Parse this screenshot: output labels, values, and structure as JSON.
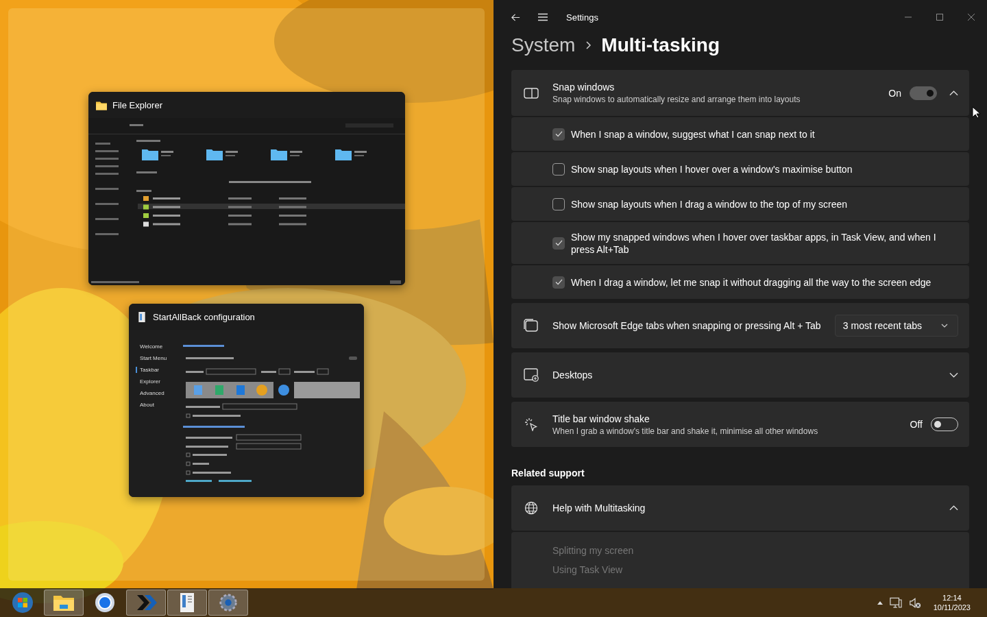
{
  "snap_assist": {
    "windows": [
      {
        "kind": "explorer",
        "title": "File Explorer"
      },
      {
        "kind": "startallback",
        "title": "StartAllBack configuration",
        "nav": [
          {
            "label": "Welcome",
            "selected": false
          },
          {
            "label": "Start Menu",
            "selected": false
          },
          {
            "label": "Taskbar",
            "selected": true
          },
          {
            "label": "Explorer",
            "selected": false
          },
          {
            "label": "Advanced",
            "selected": false
          },
          {
            "label": "About",
            "selected": false
          }
        ]
      }
    ]
  },
  "settings": {
    "window": {
      "title": "Settings"
    },
    "breadcrumb": [
      "System",
      "Multi-tasking"
    ],
    "snap_windows": {
      "title": "Snap windows",
      "description": "Snap windows to automatically resize and arrange them into layouts",
      "state_label": "On",
      "on": true,
      "expanded": true,
      "options": [
        {
          "label": "When I snap a window, suggest what I can snap next to it",
          "checked": true
        },
        {
          "label": "Show snap layouts when I hover over a window's maximise button",
          "checked": false
        },
        {
          "label": "Show snap layouts when I drag a window to the top of my screen",
          "checked": false
        },
        {
          "label": "Show my snapped windows when I hover over taskbar apps, in Task View, and when I press Alt+Tab",
          "checked": true
        },
        {
          "label": "When I drag a window, let me snap it without dragging all the way to the screen edge",
          "checked": true
        }
      ]
    },
    "edge_tabs": {
      "label": "Show Microsoft Edge tabs when snapping or pressing Alt + Tab",
      "value": "3 most recent tabs"
    },
    "desktops": {
      "label": "Desktops",
      "expanded": false
    },
    "title_bar_shake": {
      "title": "Title bar window shake",
      "description": "When I grab a window's title bar and shake it, minimise all other windows",
      "state_label": "Off",
      "on": false
    },
    "related_support": {
      "heading": "Related support",
      "help": {
        "title": "Help with Multitasking",
        "expanded": true,
        "links": [
          "Splitting my screen",
          "Using Task View"
        ]
      }
    }
  },
  "taskbar": {
    "apps": [
      {
        "kind": "start",
        "active": false
      },
      {
        "kind": "folder",
        "active": true
      },
      {
        "kind": "browser",
        "active": false
      },
      {
        "kind": "chevrons",
        "active": true
      },
      {
        "kind": "notepad",
        "active": true
      },
      {
        "kind": "gear",
        "active": true
      }
    ],
    "time": "12:14",
    "date": "10/11/2023"
  }
}
